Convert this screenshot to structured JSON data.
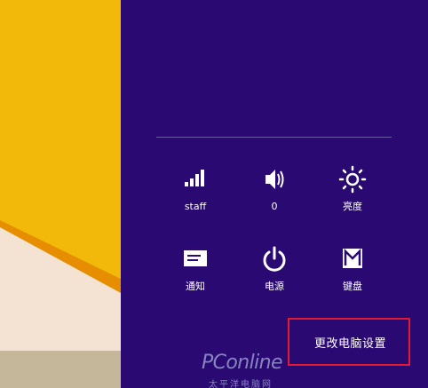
{
  "background": {
    "colors": {
      "yellow": "#f3b90a",
      "light": "#f4e3d2",
      "stripe": "#e68e00",
      "footer": "#c5b79a"
    }
  },
  "panel": {
    "color": "#2a0a72",
    "tiles": [
      {
        "label": "staff",
        "icon": "wifi-signal-icon"
      },
      {
        "label": "0",
        "icon": "volume-icon"
      },
      {
        "label": "亮度",
        "icon": "brightness-icon"
      },
      {
        "label": "通知",
        "icon": "notifications-icon"
      },
      {
        "label": "电源",
        "icon": "power-icon"
      },
      {
        "label": "键盘",
        "icon": "keyboard-icon"
      }
    ],
    "change_settings": "更改电脑设置"
  },
  "watermark": {
    "main": "PConline",
    "sub": "太平洋电脑网"
  },
  "highlight_color": "#e21a30"
}
